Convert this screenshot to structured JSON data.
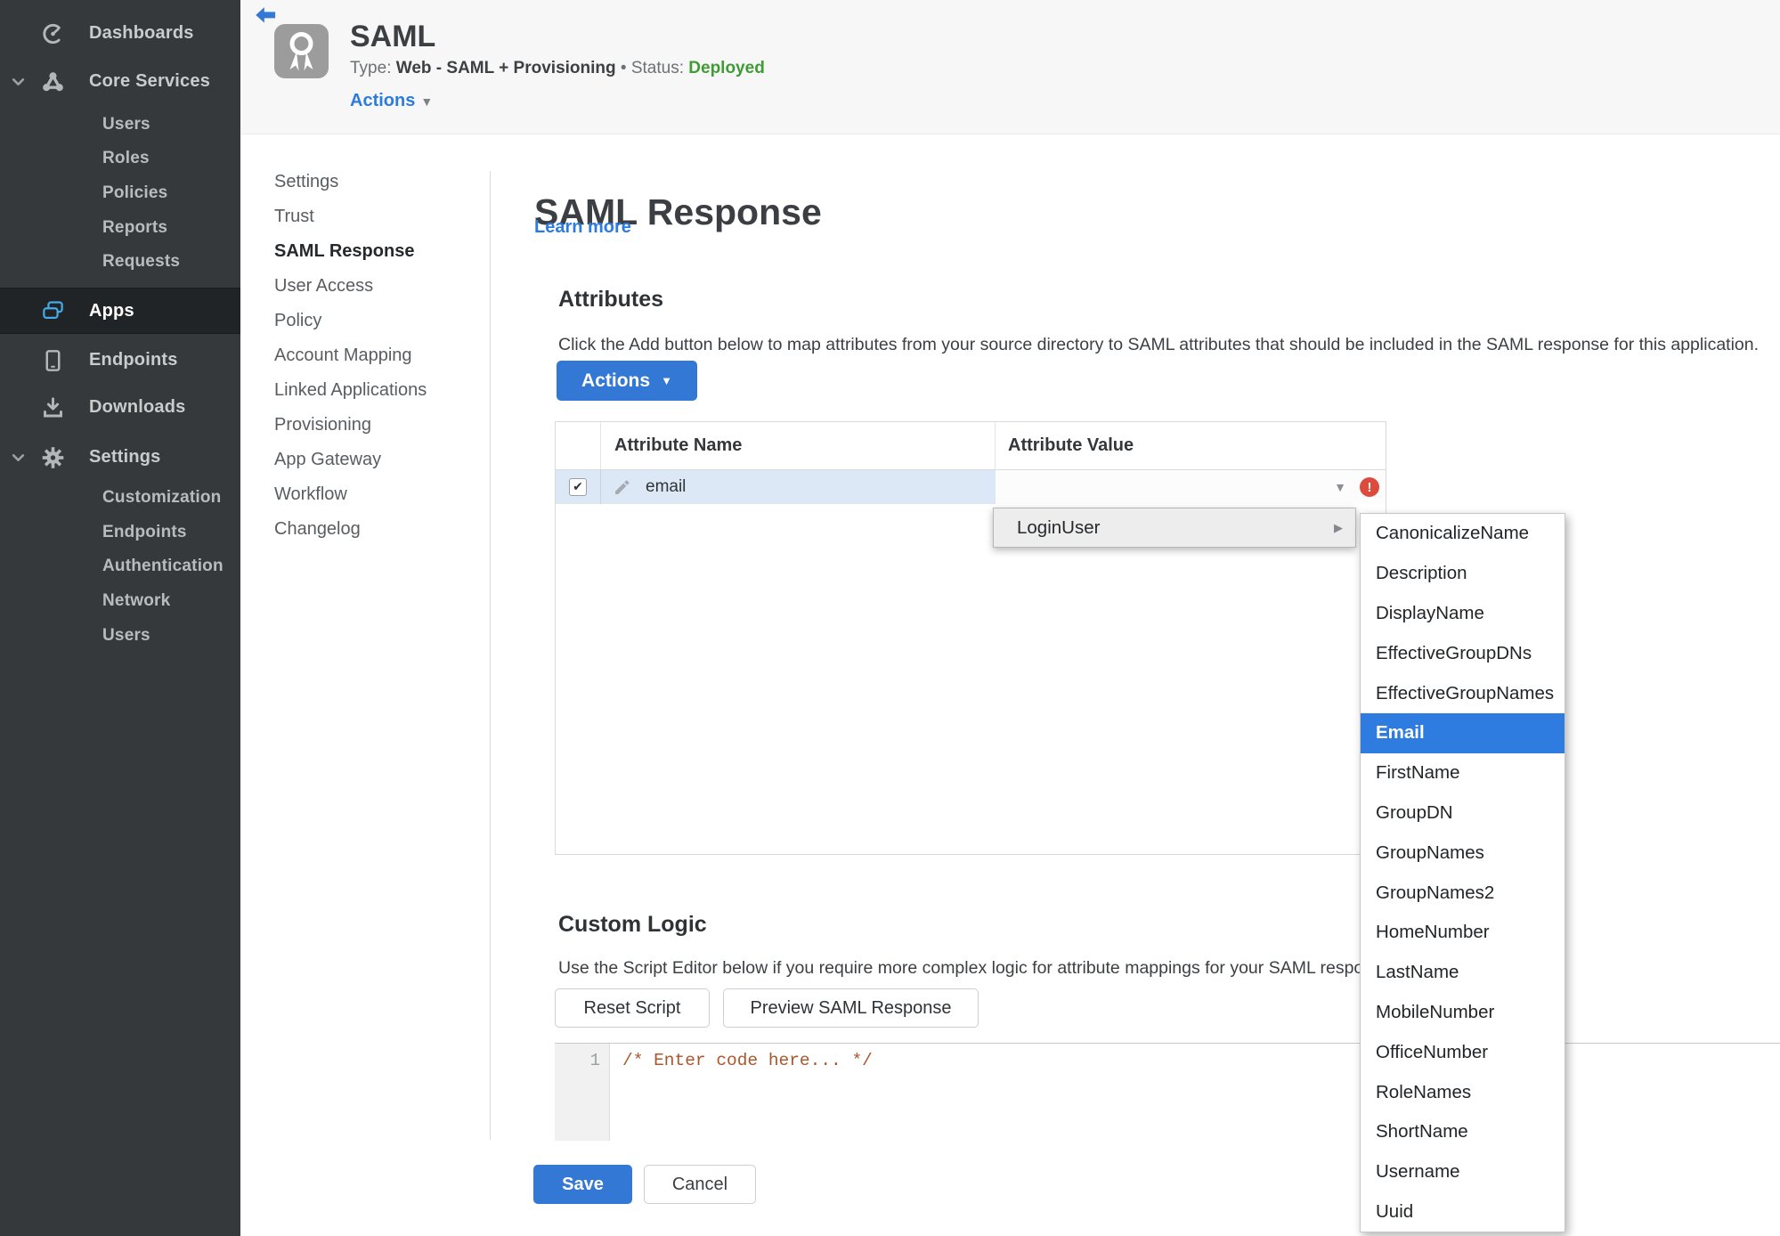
{
  "colors": {
    "accent_blue": "#3478d6",
    "link_blue": "#2c7be0",
    "selected_blue": "#2e7ce0",
    "status_green": "#3f9c35",
    "error_red": "#dc4b3c",
    "row_highlight_blue": "#dce8f6",
    "sidebar_bg": "#36393b",
    "comment_orange": "#a9572c",
    "apps_icon_blue": "#45aae8"
  },
  "icons": {
    "checkmark": "✔",
    "dropdown_arrow": "▼",
    "actions_caret": "▼",
    "submenu_arrow": "▶",
    "error_mark": "!"
  },
  "sidebar": {
    "dashboards": "Dashboards",
    "core_services": "Core Services",
    "core_children": [
      "Users",
      "Roles",
      "Policies",
      "Reports",
      "Requests"
    ],
    "apps": "Apps",
    "endpoints": "Endpoints",
    "downloads": "Downloads",
    "settings": "Settings",
    "settings_children": [
      "Customization",
      "Endpoints",
      "Authentication",
      "Network",
      "Users"
    ]
  },
  "header": {
    "title": "SAML",
    "type_label": "Type:",
    "type_value": "Web - SAML + Provisioning",
    "bullet": "•",
    "status_label": "Status:",
    "status_value": "Deployed",
    "actions_label": "Actions"
  },
  "nav": {
    "items": [
      "Settings",
      "Trust",
      "SAML Response",
      "User Access",
      "Policy",
      "Account Mapping",
      "Linked Applications",
      "Provisioning",
      "App Gateway",
      "Workflow",
      "Changelog"
    ],
    "active": "SAML Response"
  },
  "main": {
    "heading": "SAML Response",
    "learn_more": "Learn more"
  },
  "attributes": {
    "heading": "Attributes",
    "description": "Click the Add button below to map attributes from your source directory to SAML attributes that should be included in the SAML response for this application.",
    "actions_button": "Actions",
    "columns": [
      "Attribute Name",
      "Attribute Value"
    ],
    "row": {
      "name": "email",
      "checked": true
    }
  },
  "dropdown": {
    "item": "LoginUser",
    "selected": "Email",
    "submenu": [
      "CanonicalizeName",
      "Description",
      "DisplayName",
      "EffectiveGroupDNs",
      "EffectiveGroupNames",
      "Email",
      "FirstName",
      "GroupDN",
      "GroupNames",
      "GroupNames2",
      "HomeNumber",
      "LastName",
      "MobileNumber",
      "OfficeNumber",
      "RoleNames",
      "ShortName",
      "Username",
      "Uuid"
    ]
  },
  "custom_logic": {
    "heading": "Custom Logic",
    "description": "Use the Script Editor below if you require more complex logic for attribute mappings for your SAML response.",
    "reset_button": "Reset Script",
    "preview_button": "Preview SAML Response",
    "line_number": "1",
    "code": "/* Enter code here... */"
  },
  "footer": {
    "save": "Save",
    "cancel": "Cancel"
  }
}
